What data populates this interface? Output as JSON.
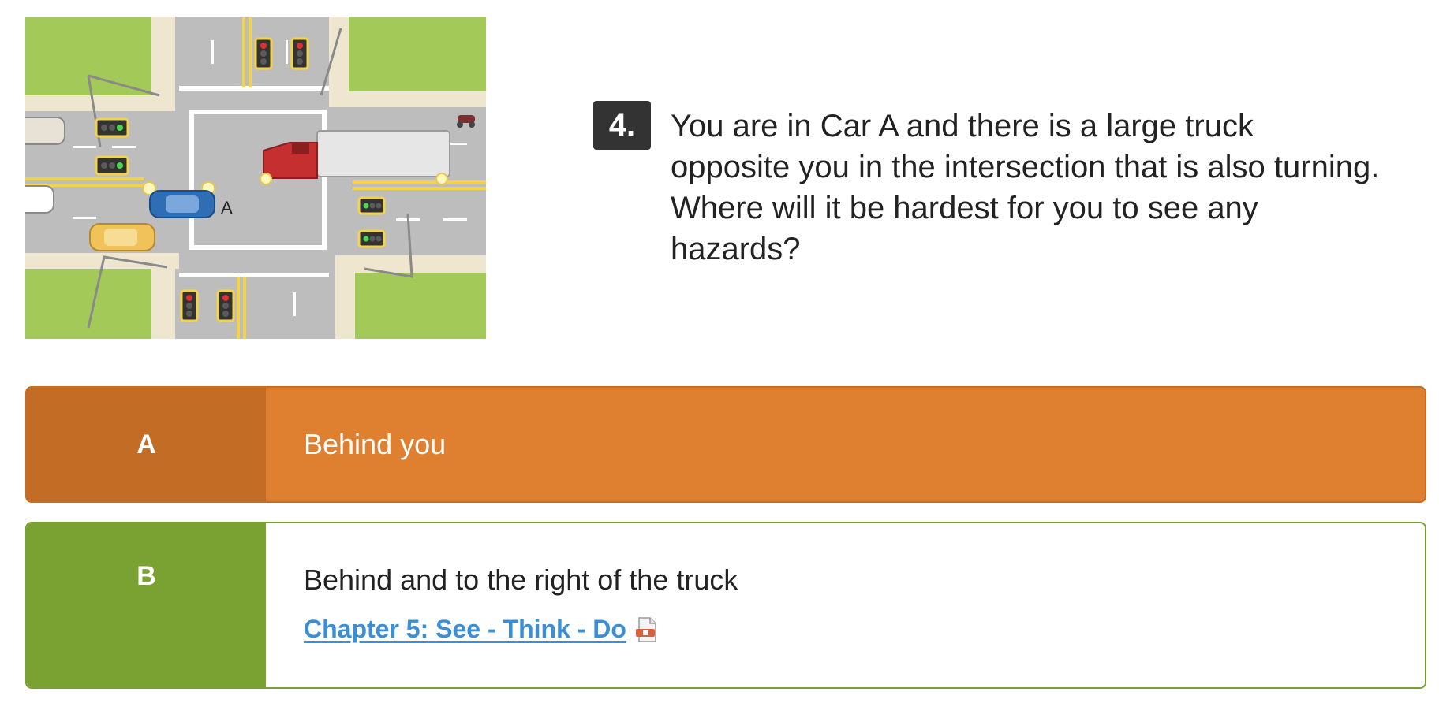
{
  "illustration": {
    "car_label": "A",
    "colors": {
      "grass": "#a3c958",
      "sidewalk": "#eee6cf",
      "road": "#bdbdbd",
      "car_a": "#2f6eb5",
      "truck_cab": "#c62f2f",
      "taxi": "#f0c25a"
    }
  },
  "question": {
    "number": "4.",
    "text": "You are in Car A and there is a large truck opposite you in the intersection that is also turning. Where will it be hardest for you to see any hazards?"
  },
  "answers": [
    {
      "letter": "A",
      "text": "Behind you",
      "state": "incorrect",
      "color": "#de8030"
    },
    {
      "letter": "B",
      "text": "Behind and to the right of the truck",
      "state": "correct",
      "color": "#7aa232",
      "reference_link": "Chapter 5: See - Think - Do",
      "reference_icon": "pdf-document-icon"
    }
  ]
}
